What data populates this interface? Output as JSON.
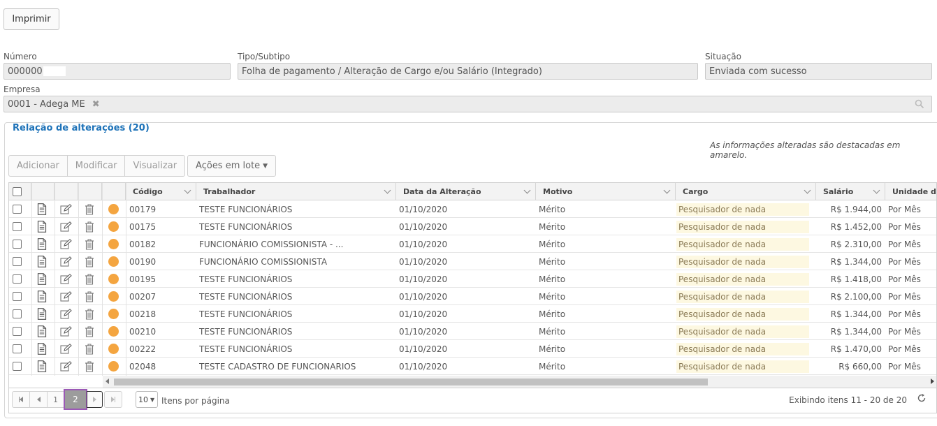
{
  "print_button": "Imprimir",
  "fields": {
    "numero": {
      "label": "Número",
      "value": "000000"
    },
    "tipo": {
      "label": "Tipo/Subtipo",
      "value": "Folha de pagamento / Alteração de Cargo e/ou Salário (Integrado)"
    },
    "situacao": {
      "label": "Situação",
      "value": "Enviada com sucesso"
    },
    "empresa": {
      "label": "Empresa",
      "value": "0001 - Adega ME"
    }
  },
  "section": {
    "title": "Relação de alterações (20)",
    "note": "As informações alteradas são destacadas em amarelo."
  },
  "toolbar": {
    "adicionar": "Adicionar",
    "modificar": "Modificar",
    "visualizar": "Visualizar",
    "acoes": "Ações em lote"
  },
  "columns": [
    "Código",
    "Trabalhador",
    "Data da Alteração",
    "Motivo",
    "Cargo",
    "Salário",
    "Unidade de"
  ],
  "rows": [
    {
      "codigo": "00179",
      "trabalhador": "TESTE FUNCIONÁRIOS",
      "data": "01/10/2020",
      "motivo": "Mérito",
      "cargo": "Pesquisador de nada",
      "salario": "R$ 1.944,00",
      "unidade": "Por Mês"
    },
    {
      "codigo": "00175",
      "trabalhador": "TESTE FUNCIONÁRIOS",
      "data": "01/10/2020",
      "motivo": "Mérito",
      "cargo": "Pesquisador de nada",
      "salario": "R$ 1.452,00",
      "unidade": "Por Mês"
    },
    {
      "codigo": "00182",
      "trabalhador": "FUNCIONÁRIO COMISSIONISTA - ...",
      "data": "01/10/2020",
      "motivo": "Mérito",
      "cargo": "Pesquisador de nada",
      "salario": "R$ 2.310,00",
      "unidade": "Por Mês"
    },
    {
      "codigo": "00190",
      "trabalhador": "FUNCIONÁRIO COMISSIONISTA",
      "data": "01/10/2020",
      "motivo": "Mérito",
      "cargo": "Pesquisador de nada",
      "salario": "R$ 1.344,00",
      "unidade": "Por Mês"
    },
    {
      "codigo": "00195",
      "trabalhador": "TESTE FUNCIONÁRIOS",
      "data": "01/10/2020",
      "motivo": "Mérito",
      "cargo": "Pesquisador de nada",
      "salario": "R$ 1.418,00",
      "unidade": "Por Mês"
    },
    {
      "codigo": "00207",
      "trabalhador": "TESTE FUNCIONÁRIOS",
      "data": "01/10/2020",
      "motivo": "Mérito",
      "cargo": "Pesquisador de nada",
      "salario": "R$ 2.100,00",
      "unidade": "Por Mês"
    },
    {
      "codigo": "00218",
      "trabalhador": "TESTE FUNCIONÁRIOS",
      "data": "01/10/2020",
      "motivo": "Mérito",
      "cargo": "Pesquisador de nada",
      "salario": "R$ 1.344,00",
      "unidade": "Por Mês"
    },
    {
      "codigo": "00210",
      "trabalhador": "TESTE FUNCIONÁRIOS",
      "data": "01/10/2020",
      "motivo": "Mérito",
      "cargo": "Pesquisador de nada",
      "salario": "R$ 1.344,00",
      "unidade": "Por Mês"
    },
    {
      "codigo": "00222",
      "trabalhador": "TESTE FUNCIONÁRIOS",
      "data": "01/10/2020",
      "motivo": "Mérito",
      "cargo": "Pesquisador de nada",
      "salario": "R$ 1.470,00",
      "unidade": "Por Mês"
    },
    {
      "codigo": "02048",
      "trabalhador": "TESTE CADASTRO DE FUNCIONARIOS",
      "data": "01/10/2020",
      "motivo": "Mérito",
      "cargo": "Pesquisador de nada",
      "salario": "R$ 660,00",
      "unidade": "Por Mês"
    }
  ],
  "pager": {
    "page_prev": "1",
    "page_current": "2",
    "page_size": "10",
    "page_size_label": "Itens por página",
    "summary": "Exibindo itens 11 - 20 de 20"
  },
  "colors": {
    "accent": "#1d72b8",
    "status_dot": "#f4a540",
    "highlight": "#fdf8e1",
    "current_page_border": "#9b59b6"
  }
}
